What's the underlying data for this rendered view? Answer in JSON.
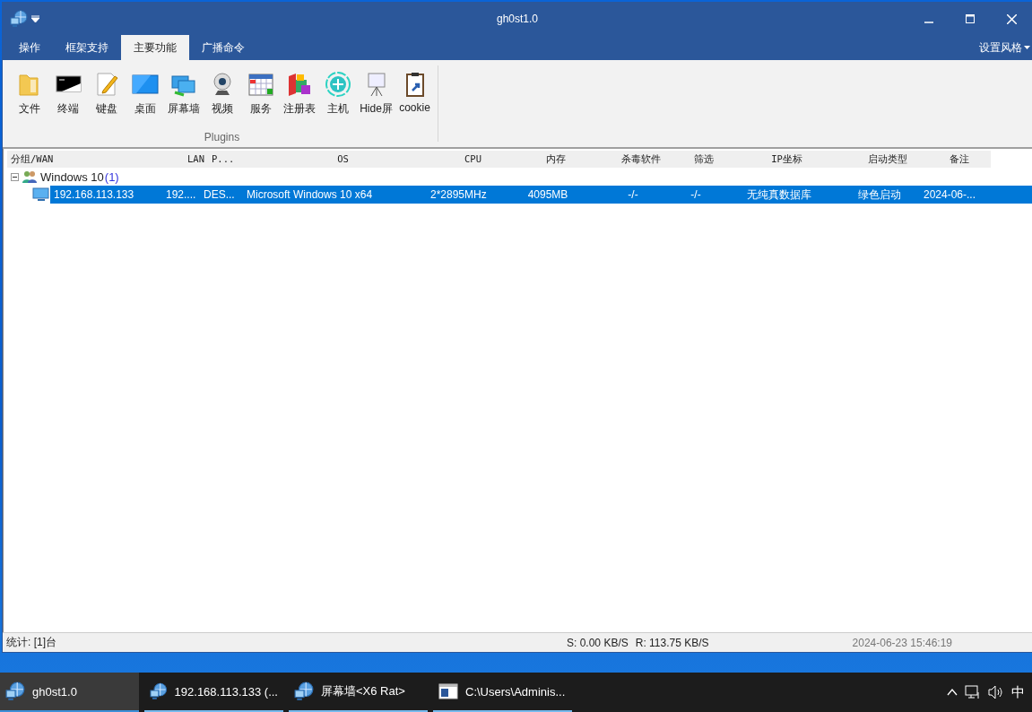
{
  "window": {
    "title": "gh0st1.0",
    "style_menu": "设置风格"
  },
  "ribbon_tabs": [
    {
      "label": "操作",
      "selected": false
    },
    {
      "label": "框架支持",
      "selected": false
    },
    {
      "label": "主要功能",
      "selected": true
    },
    {
      "label": "广播命令",
      "selected": false
    }
  ],
  "ribbon": {
    "group_label": "Plugins",
    "buttons": [
      {
        "label": "文件",
        "kind": "folder"
      },
      {
        "label": "终端",
        "kind": "terminal"
      },
      {
        "label": "键盘",
        "kind": "notepad"
      },
      {
        "label": "桌面",
        "kind": "monitor"
      },
      {
        "label": "屏幕墙",
        "kind": "screens"
      },
      {
        "label": "视频",
        "kind": "webcam"
      },
      {
        "label": "服务",
        "kind": "calendar"
      },
      {
        "label": "注册表",
        "kind": "blocks"
      },
      {
        "label": "主机",
        "kind": "circle"
      },
      {
        "label": "Hide屏",
        "kind": "easel"
      },
      {
        "label": "cookie",
        "kind": "clipboard"
      }
    ]
  },
  "table": {
    "columns": [
      "分组/WAN",
      "LAN",
      "P...",
      "OS",
      "CPU",
      "内存",
      "杀毒软件",
      "筛选",
      "IP坐标",
      "启动类型",
      "备注"
    ],
    "groups": [
      {
        "label": "Windows 10",
        "count": "(1)",
        "expanded": true,
        "children": [
          {
            "selected": true,
            "cells": [
              "192.168.113.133",
              "192....",
              "DES...",
              "Microsoft Windows 10 x64",
              "2*2895MHz",
              "4095MB",
              "-/-",
              "-/-",
              "无纯真数据库",
              "绿色启动",
              "2024-06-..."
            ]
          }
        ]
      }
    ]
  },
  "status_bar": {
    "count": "统计: [1]台",
    "send": "S: 0.00 KB/S",
    "receive": "R: 113.75 KB/S",
    "time": "2024-06-23 15:46:19"
  },
  "taskbar": {
    "items": [
      {
        "label": "gh0st1.0",
        "kind": "globe",
        "selected": true
      },
      {
        "label": "192.168.113.133 (...",
        "kind": "globe",
        "selected": false
      },
      {
        "label": "屏幕墙<X6 Rat>",
        "kind": "globe",
        "selected": false
      },
      {
        "label": "C:\\Users\\Adminis...",
        "kind": "console",
        "selected": false
      }
    ],
    "ime": "中"
  }
}
